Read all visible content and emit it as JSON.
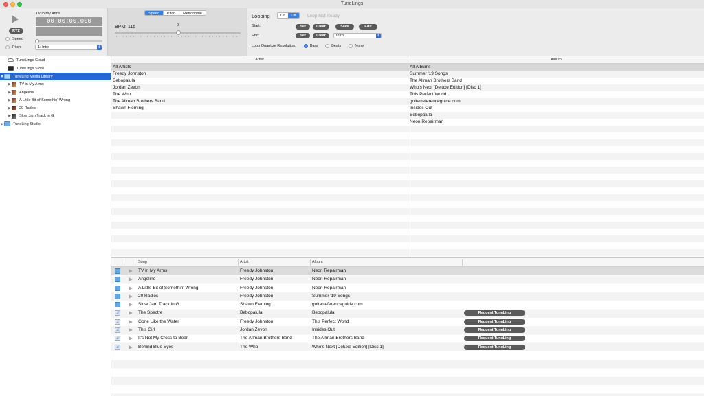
{
  "window": {
    "title": "TuneLings"
  },
  "player": {
    "song_title": "TV in My Arms",
    "time": "00:00:00.000",
    "rtz_label": "RTZ",
    "modes": [
      "Speed",
      "Pitch"
    ],
    "section": "1: Intro"
  },
  "adjust": {
    "tabs": [
      "Speed",
      "Pitch",
      "Metronome"
    ],
    "active_tab": "Speed",
    "bpm_label": "BPM: 115",
    "offset": "0"
  },
  "looping": {
    "label": "Looping",
    "on_label": "On",
    "off_label": "Off",
    "status": "Loop Not Ready",
    "start_label": "Start:",
    "end_label": "End:",
    "set_label": "Set",
    "clear_label": "Clear",
    "save_label": "Save",
    "edit_label": "Edit",
    "end_section": "Intro",
    "quantize_label": "Loop Quantize Resolution:",
    "quantize_options": [
      "Bars",
      "Beats",
      "None"
    ],
    "quantize_selected": "Bars"
  },
  "sidebar": {
    "items": [
      {
        "label": "TuneLings Cloud"
      },
      {
        "label": "TuneLings Store"
      },
      {
        "label": "TuneLing Media Library"
      },
      {
        "label": "TV in My Arms"
      },
      {
        "label": "Angeline"
      },
      {
        "label": "A Little Bit of Somethin' Wrong"
      },
      {
        "label": "20 Radios"
      },
      {
        "label": "Slow Jam Track in G"
      },
      {
        "label": "TuneLing Studio"
      }
    ]
  },
  "artist_browser": {
    "header": "Artist",
    "rows": [
      "All Artists",
      "Freedy Johnston",
      "Bebopalula",
      "Jordan Zevon",
      "The Who",
      "The Allman Brothers Band",
      "Shawn Fleming"
    ]
  },
  "album_browser": {
    "header": "Album",
    "rows": [
      "All Albums",
      "Summer '19 Songs",
      "The Allman Brothers Band",
      "Who's Next [Deluxe Edition] [Disc 1]",
      "This Perfect World",
      "guitarreferenceguide.com",
      "Insides Out",
      "Bebopalula",
      "Neon Repairman"
    ]
  },
  "songs": {
    "columns": {
      "song": "Song",
      "artist": "Artist",
      "album": "Album"
    },
    "request_label": "Request TuneLing",
    "rows": [
      {
        "song": "TV in My Arms",
        "artist": "Freedy Johnston",
        "album": "Neon Repairman"
      },
      {
        "song": "Angeline",
        "artist": "Freedy Johnston",
        "album": "Neon Repairman"
      },
      {
        "song": "A Little Bit of Somethin' Wrong",
        "artist": "Freedy Johnston",
        "album": "Neon Repairman"
      },
      {
        "song": "20 Radios",
        "artist": "Freedy Johnston",
        "album": "Summer '19 Songs"
      },
      {
        "song": "Slow Jam Track in G",
        "artist": "Shawn Fleming",
        "album": "guitarreferenceguide.com"
      },
      {
        "song": "The Spectre",
        "artist": "Bebopalula",
        "album": "Bebopalula"
      },
      {
        "song": "Gone Like the Water",
        "artist": "Freedy Johnston",
        "album": "This Perfect World"
      },
      {
        "song": "This Girl",
        "artist": "Jordan Zevon",
        "album": "Insides Out"
      },
      {
        "song": "It's Not My Cross to Bear",
        "artist": "The Allman Brothers Band",
        "album": "The Allman Brothers Band"
      },
      {
        "song": "Behind Blue Eyes",
        "artist": "The Who",
        "album": "Who's Next [Deluxe Edition] [Disc 1]"
      }
    ]
  }
}
